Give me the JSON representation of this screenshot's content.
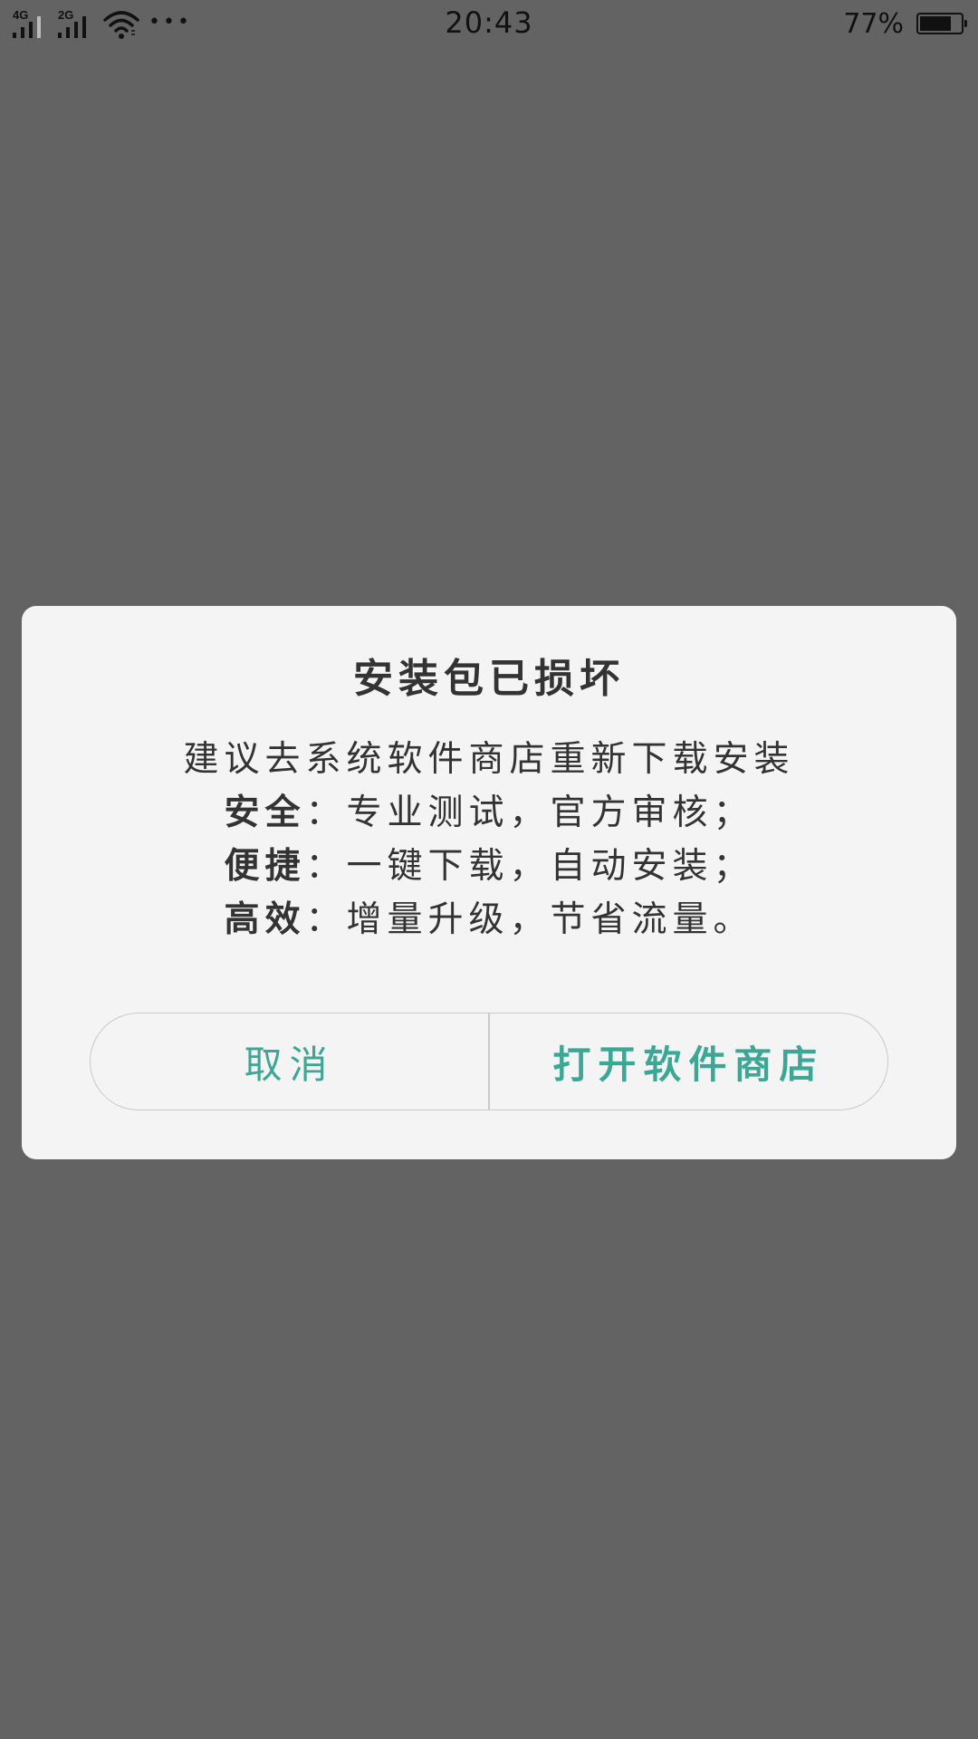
{
  "status_bar": {
    "signal1_label": "4G",
    "signal2_label": "2G",
    "more_glyph": "•••",
    "time": "20:43",
    "battery_percent_text": "77%",
    "battery_level": 0.77
  },
  "dialog": {
    "title": "安装包已损坏",
    "message": "建议去系统软件商店重新下载安装",
    "features": [
      {
        "label": "安全",
        "sep": "：",
        "text": "专业测试，官方审核；"
      },
      {
        "label": "便捷",
        "sep": "：",
        "text": "一键下载，自动安装；"
      },
      {
        "label": "高效",
        "sep": "：",
        "text": "增量升级，节省流量。"
      }
    ],
    "cancel_label": "取消",
    "confirm_label": "打开软件商店"
  },
  "colors": {
    "backdrop": "#636363",
    "dialog_bg": "#f4f4f4",
    "accent": "#3aa894",
    "text": "#333333"
  }
}
